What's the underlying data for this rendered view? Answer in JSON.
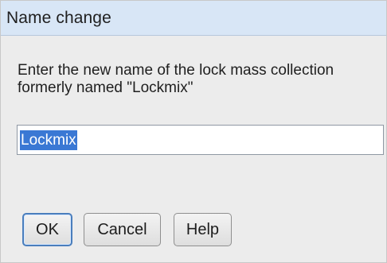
{
  "dialog": {
    "title": "Name change",
    "prompt_line_1": "Enter the new name of the lock mass collection",
    "prompt_line_2": "formerly named \"Lockmix\"",
    "field_value": "Lockmix",
    "buttons": {
      "ok": "OK",
      "cancel": "Cancel",
      "help": "Help"
    },
    "colors": {
      "titlebar": "#d8e6f6",
      "selection": "#3a78d4",
      "default_button_border": "#4a7ebd"
    }
  }
}
